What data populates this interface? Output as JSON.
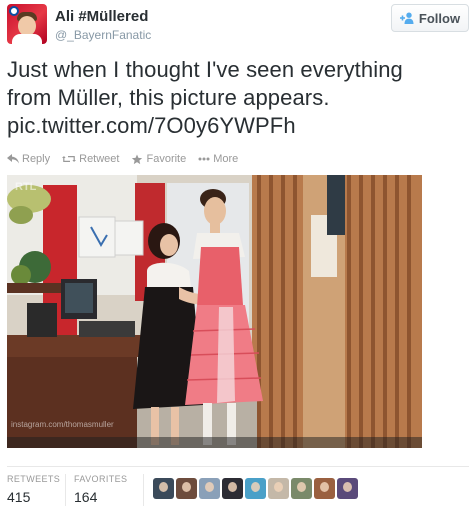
{
  "user": {
    "name": "Ali #Müllered",
    "handle": "@_BayernFanatic",
    "avatar_icon": "user-avatar-icon"
  },
  "follow_button": {
    "label": "Follow",
    "icon": "follow-person-icon"
  },
  "tweet": {
    "line1": "Just when I thought I've seen everything",
    "line2": "from Müller, this picture appears.",
    "link": "pic.twitter.com/7O0y6YWPFh"
  },
  "actions": {
    "reply": "Reply",
    "retweet": "Retweet",
    "favorite": "Favorite",
    "more": "More"
  },
  "photo": {
    "overlay_text": "RTL",
    "caption": "instagram.com/thomasmuller"
  },
  "stats": {
    "retweets_label": "RETWEETS",
    "retweets_value": "415",
    "favorites_label": "FAVORITES",
    "favorites_value": "164"
  },
  "favoriters": [
    {
      "color": "#3b4a5a"
    },
    {
      "color": "#6d4c3d"
    },
    {
      "color": "#8aa0b8"
    },
    {
      "color": "#2c2c34"
    },
    {
      "color": "#4aa0c8"
    },
    {
      "color": "#c4b8a8"
    },
    {
      "color": "#7a8a6a"
    },
    {
      "color": "#9a6040"
    },
    {
      "color": "#5a4a7a"
    }
  ],
  "colors": {
    "text": "#292f33",
    "muted": "#8899a6",
    "follow_icon": "#55acee",
    "dirndl": "#e8606a"
  }
}
